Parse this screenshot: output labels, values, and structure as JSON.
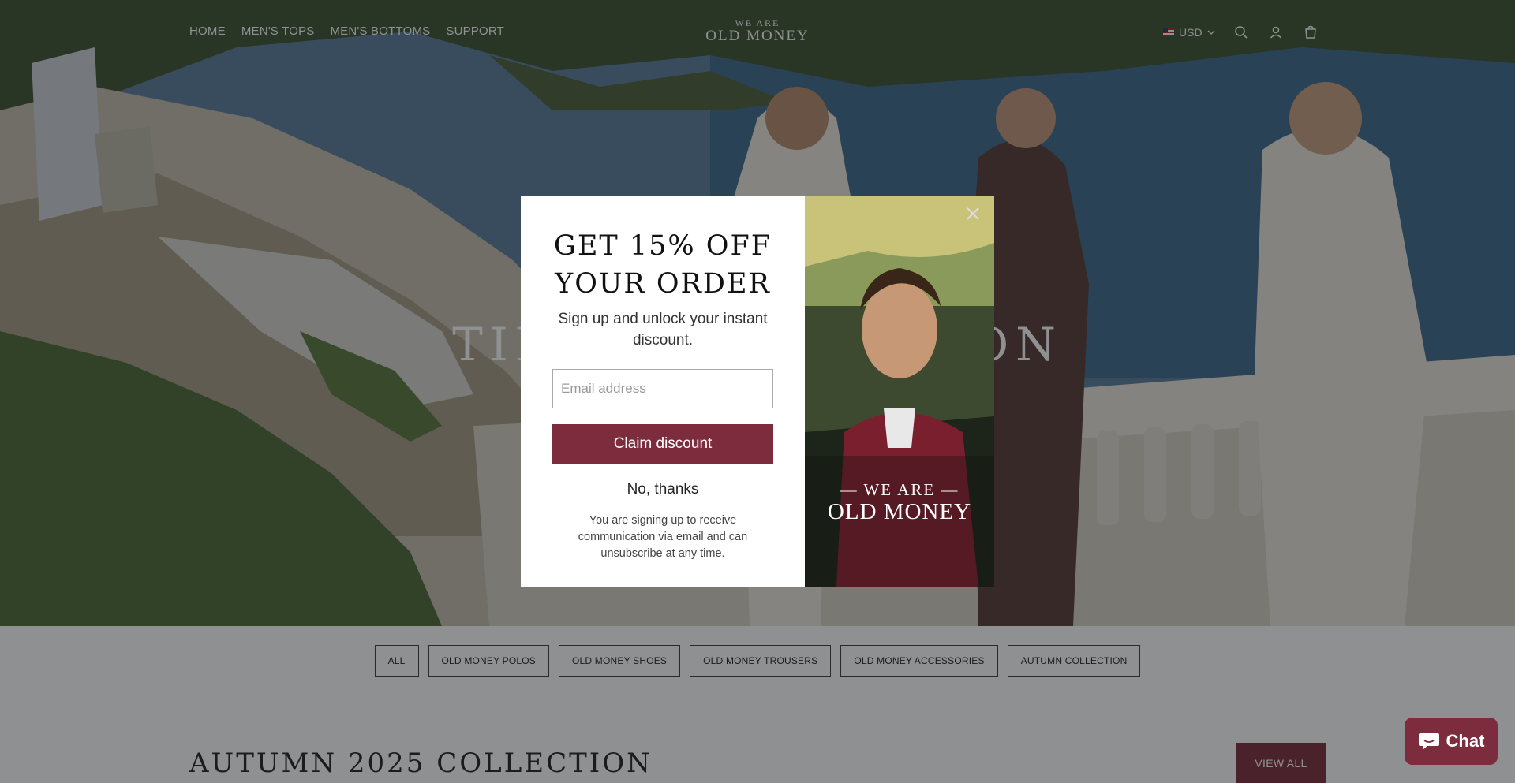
{
  "header": {
    "nav": [
      {
        "label": "HOME"
      },
      {
        "label": "MEN'S TOPS"
      },
      {
        "label": "MEN'S BOTTOMS"
      },
      {
        "label": "SUPPORT"
      }
    ],
    "logo_top": "— WE ARE —",
    "logo_bottom": "OLD MONEY",
    "currency": "USD",
    "icons": [
      "flag-icon",
      "chevron-down-icon",
      "search-icon",
      "account-icon",
      "cart-icon"
    ]
  },
  "hero": {
    "title": "TIMELESS FASHION"
  },
  "filters": [
    "ALL",
    "OLD MONEY POLOS",
    "OLD MONEY SHOES",
    "OLD MONEY TROUSERS",
    "OLD MONEY ACCESSORIES",
    "AUTUMN COLLECTION"
  ],
  "section": {
    "title": "AUTUMN 2025 COLLECTION",
    "view_all": "VIEW ALL"
  },
  "modal": {
    "heading_line1": "GET 15% OFF",
    "heading_line2": "YOUR ORDER",
    "subtitle": "Sign up and unlock your instant discount.",
    "email_placeholder": "Email address",
    "claim_label": "Claim discount",
    "no_thanks_label": "No, thanks",
    "legal": "You are signing up to receive communication via email and can unsubscribe at any time.",
    "promo_top": "— WE ARE —",
    "promo_bottom": "OLD MONEY"
  },
  "chat": {
    "label": "Chat"
  },
  "colors": {
    "accent": "#7d2c3d",
    "overlay": "rgba(18,22,28,0.48)"
  }
}
